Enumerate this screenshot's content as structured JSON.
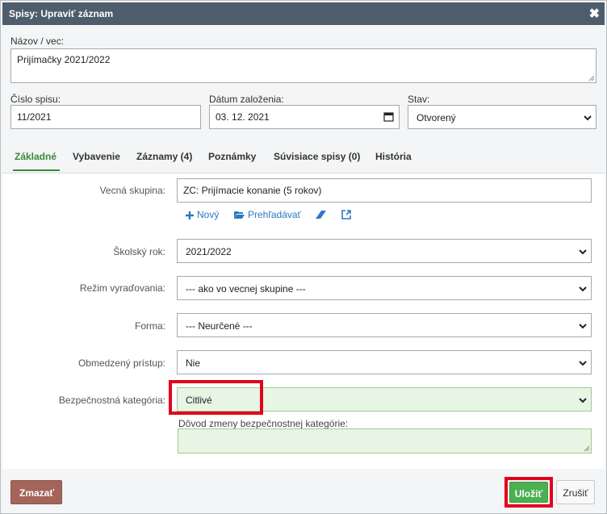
{
  "dialog": {
    "title": "Spisy: Upraviť záznam"
  },
  "header": {
    "name_label": "Názov / vec:",
    "name_value": "Prijímačky 2021/2022",
    "file_no_label": "Číslo spisu:",
    "file_no_value": "11/2021",
    "date_label": "Dátum založenia:",
    "date_value": "03. 12. 2021",
    "status_label": "Stav:",
    "status_value": "Otvorený"
  },
  "tabs": [
    {
      "label": "Základné",
      "active": true
    },
    {
      "label": "Vybavenie"
    },
    {
      "label": "Záznamy (4)"
    },
    {
      "label": "Poznámky"
    },
    {
      "label": "Súvisiace spisy (0)"
    },
    {
      "label": "História"
    }
  ],
  "form": {
    "group_label": "Vecná skupina:",
    "group_value": "ZC: Prijímacie konanie (5 rokov)",
    "actions": {
      "new": "Nový",
      "browse": "Prehľadávať"
    },
    "year_label": "Školský rok:",
    "year_value": "2021/2022",
    "discard_label": "Režim vyraďovania:",
    "discard_value": "--- ako vo vecnej skupine ---",
    "form_label": "Forma:",
    "form_value": "--- Neurčené ---",
    "restricted_label": "Obmedzený prístup:",
    "restricted_value": "Nie",
    "security_label": "Bezpečnostná kategória:",
    "security_value": "Citlivé",
    "reason_label": "Dôvod zmeny bezpečnostnej kategórie:",
    "reason_value": ""
  },
  "buttons": {
    "delete": "Zmazať",
    "save": "Uložiť",
    "cancel": "Zrušiť"
  },
  "colors": {
    "titlebar": "#4e5d6c",
    "accent_green": "#4caf50",
    "highlight_red": "#e3001b",
    "link_blue": "#2b79c2"
  }
}
